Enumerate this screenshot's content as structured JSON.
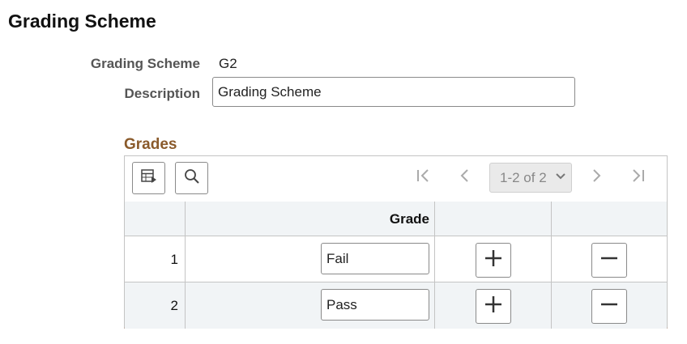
{
  "page": {
    "title": "Grading Scheme"
  },
  "form": {
    "scheme_label": "Grading Scheme",
    "scheme_value": "G2",
    "description_label": "Description",
    "description_value": "Grading Scheme"
  },
  "grid": {
    "title": "Grades",
    "pager_text": "1-2 of 2",
    "columns": {
      "grade": "Grade"
    },
    "icons": {
      "personalize": "grid-personalize-icon",
      "search": "search-icon",
      "first": "first-page-icon",
      "prev": "previous-page-icon",
      "next": "next-page-icon",
      "last": "last-page-icon",
      "add": "plus-icon",
      "delete": "minus-icon"
    },
    "rows": [
      {
        "num": "1",
        "grade": "Fail"
      },
      {
        "num": "2",
        "grade": "Pass"
      }
    ]
  }
}
